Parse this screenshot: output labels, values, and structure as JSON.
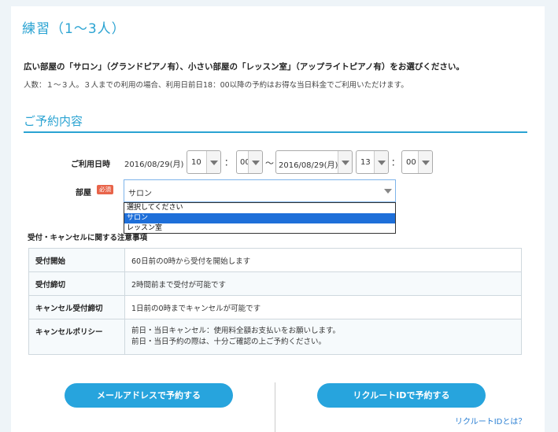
{
  "page": {
    "title": "練習（1〜3人）",
    "lead": "広い部屋の「サロン」（グランドピアノ有）、小さい部屋の「レッスン室」（アップライトピアノ有）をお選びください。",
    "note": "人数：１〜３人。３人までの利用の場合、利用日前日18：00以降の予約はお得な当日料金でご利用いただけます。"
  },
  "reservation": {
    "section_title": "ご予約内容",
    "date_label": "ご利用日時",
    "start_date": "2016/08/29(月)",
    "start_hour": "10",
    "start_minute": "00",
    "colon": "：",
    "tilde": "〜",
    "end_date": "2016/08/29(月)",
    "end_hour": "13",
    "end_minute": "00",
    "room_label": "部屋",
    "required_badge": "必須",
    "room_value": "サロン",
    "room_options": [
      "選択してください",
      "サロン",
      "レッスン室"
    ]
  },
  "notices": {
    "caption": "受付・キャンセルに関する注意事項",
    "rows": [
      {
        "key": "受付開始",
        "value": [
          "60日前の0時から受付を開始します"
        ]
      },
      {
        "key": "受付締切",
        "value": [
          "2時間前まで受付が可能です"
        ]
      },
      {
        "key": "キャンセル受付締切",
        "value": [
          "1日前の0時までキャンセルが可能です"
        ]
      },
      {
        "key": "キャンセルポリシー",
        "value": [
          "前日・当日キャンセル：使用料全額お支払いをお願いします。",
          "前日・当日予約の際は、十分ご確認の上ご予約ください。"
        ]
      }
    ]
  },
  "actions": {
    "email_button": "メールアドレスで予約する",
    "recruit_button": "リクルートIDで予約する",
    "recruit_link": "リクルートIDとは？"
  },
  "colors": {
    "accent": "#2aa3d2",
    "button": "#27a4dd",
    "badge": "#e8644a",
    "dropdown_active": "#1e6fd9"
  }
}
